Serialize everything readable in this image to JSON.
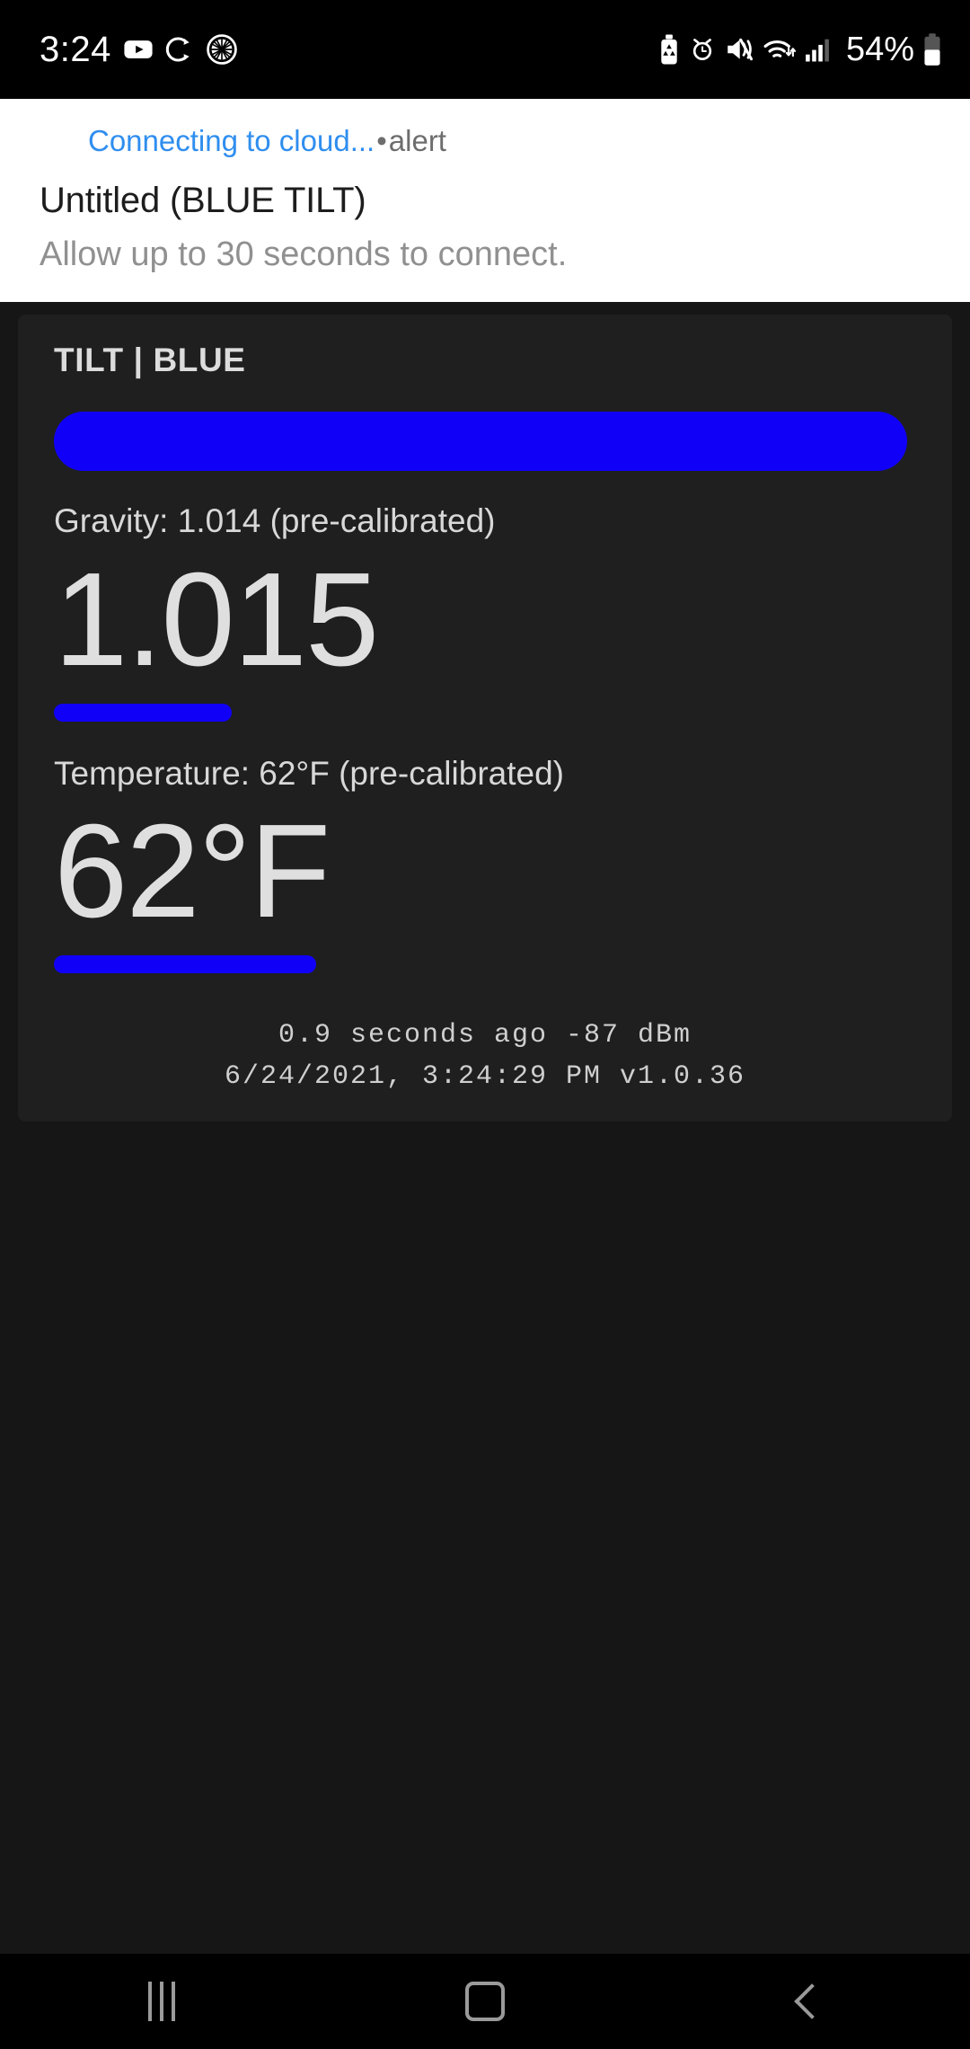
{
  "status_bar": {
    "clock": "3:24",
    "battery_percent": "54%",
    "icons": [
      "youtube-icon",
      "sync-rotate-icon",
      "citrus-wheel-icon",
      "sanitizer-bottle-icon",
      "alarm-clock-icon",
      "mute-vibrate-icon",
      "wifi-icon",
      "cellular-signal-icon",
      "battery-icon"
    ]
  },
  "header": {
    "alert_link": "Connecting to cloud...",
    "alert_separator": "•",
    "alert_tag": "alert",
    "title": "Untitled (BLUE TILT)",
    "subtitle": "Allow up to 30 seconds to connect."
  },
  "card": {
    "title": "TILT | BLUE",
    "banner_color": "#1100f7",
    "gravity": {
      "label": "Gravity: 1.014 (pre-calibrated)",
      "value": "1.015",
      "calibrated_value": "1.014",
      "calibration_note": "pre-calibrated",
      "accent_color": "#1100f7"
    },
    "temperature": {
      "label": "Temperature: 62°F (pre-calibrated)",
      "value": "62°F",
      "calibrated_value": "62°F",
      "calibration_note": "pre-calibrated",
      "accent_color": "#1100f7"
    },
    "footer": {
      "line1": "0.9 seconds ago -87 dBm",
      "line2": "6/24/2021, 3:24:29 PM v1.0.36",
      "elapsed": "0.9 seconds ago",
      "signal": "-87 dBm",
      "timestamp": "6/24/2021, 3:24:29 PM",
      "version": "v1.0.36"
    }
  },
  "nav_bar": {
    "recents_label": "Recents",
    "home_label": "Home",
    "back_label": "Back"
  }
}
